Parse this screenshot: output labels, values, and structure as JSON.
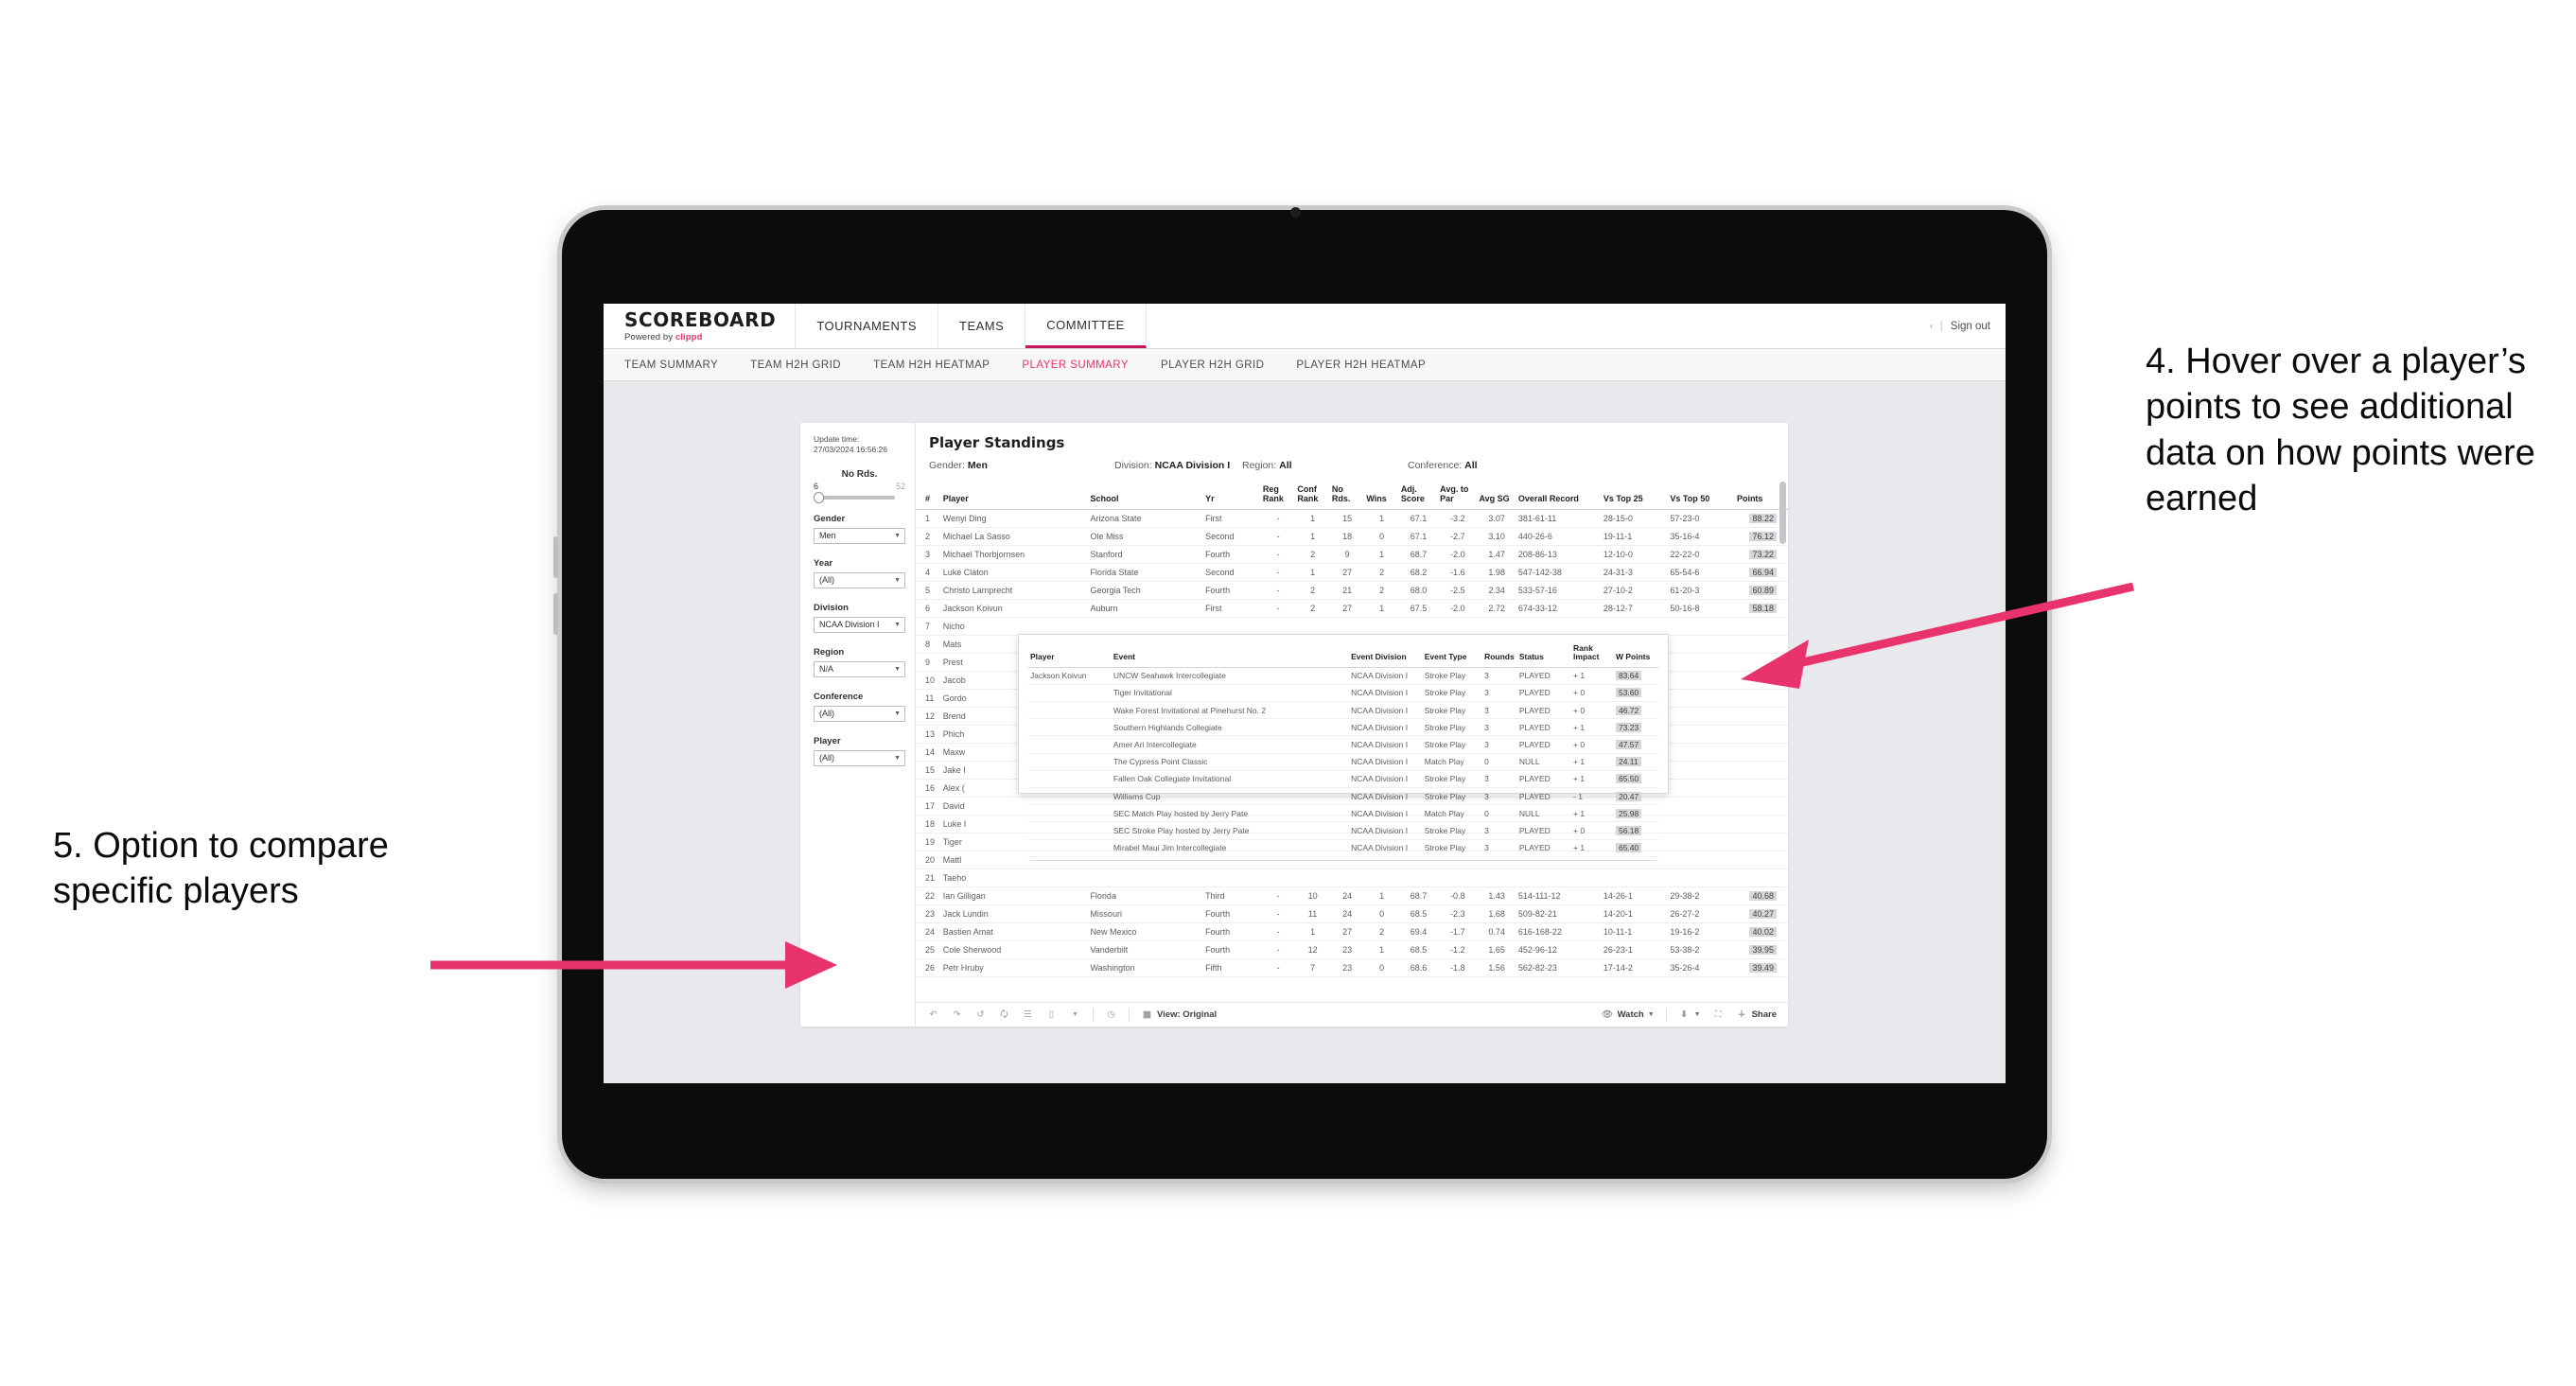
{
  "brand": {
    "title": "SCOREBOARD",
    "powered_prefix": "Powered by ",
    "powered_name": "clippd",
    "accent": "#e8336d"
  },
  "topnav": {
    "items": [
      "TOURNAMENTS",
      "TEAMS",
      "COMMITTEE"
    ],
    "active": "COMMITTEE",
    "sign_out": "Sign out",
    "divider": "|",
    "caret": "‹"
  },
  "subnav": {
    "items": [
      "TEAM SUMMARY",
      "TEAM H2H GRID",
      "TEAM H2H HEATMAP",
      "PLAYER SUMMARY",
      "PLAYER H2H GRID",
      "PLAYER H2H HEATMAP"
    ],
    "active": "PLAYER SUMMARY",
    "active_color": "#e8336d"
  },
  "update": {
    "label": "Update time:",
    "value": "27/03/2024 16:56:26"
  },
  "panel": {
    "title": "Player Standings",
    "meta": [
      {
        "label": "Gender: ",
        "value": "Men"
      },
      {
        "label": "Division: ",
        "value": "NCAA Division I"
      },
      {
        "label": "Region: ",
        "value": "All"
      },
      {
        "label": "Conference: ",
        "value": "All"
      }
    ]
  },
  "filters": {
    "slider": {
      "title": "No Rds.",
      "min": "6",
      "max": "52"
    },
    "groups": [
      {
        "label": "Gender",
        "value": "Men"
      },
      {
        "label": "Year",
        "value": "(All)"
      },
      {
        "label": "Division",
        "value": "NCAA Division I"
      },
      {
        "label": "Region",
        "value": "N/A"
      },
      {
        "label": "Conference",
        "value": "(All)"
      },
      {
        "label": "Player",
        "value": "(All)"
      }
    ]
  },
  "table": {
    "headers": [
      "#",
      "Player",
      "School",
      "Yr",
      "Reg Rank",
      "Conf Rank",
      "No Rds.",
      "Wins",
      "Adj. Score",
      "Avg. to Par",
      "Avg SG",
      "Overall Record",
      "Vs Top 25",
      "Vs Top 50",
      "Points"
    ],
    "rows": [
      {
        "rank": "1",
        "player": "Wenyi Ding",
        "school": "Arizona State",
        "yr": "First",
        "reg": "-",
        "conf": "1",
        "rds": "15",
        "wins": "1",
        "adj": "67.1",
        "par": "-3.2",
        "sg": "3.07",
        "record": "381-61-11",
        "t25": "28-15-0",
        "t50": "57-23-0",
        "points": "88.22"
      },
      {
        "rank": "2",
        "player": "Michael La Sasso",
        "school": "Ole Miss",
        "yr": "Second",
        "reg": "-",
        "conf": "1",
        "rds": "18",
        "wins": "0",
        "adj": "67.1",
        "par": "-2.7",
        "sg": "3.10",
        "record": "440-26-6",
        "t25": "19-11-1",
        "t50": "35-16-4",
        "points": "76.12"
      },
      {
        "rank": "3",
        "player": "Michael Thorbjornsen",
        "school": "Stanford",
        "yr": "Fourth",
        "reg": "-",
        "conf": "2",
        "rds": "9",
        "wins": "1",
        "adj": "68.7",
        "par": "-2.0",
        "sg": "1.47",
        "record": "208-86-13",
        "t25": "12-10-0",
        "t50": "22-22-0",
        "points": "73.22"
      },
      {
        "rank": "4",
        "player": "Luke Claton",
        "school": "Florida State",
        "yr": "Second",
        "reg": "-",
        "conf": "1",
        "rds": "27",
        "wins": "2",
        "adj": "68.2",
        "par": "-1.6",
        "sg": "1.98",
        "record": "547-142-38",
        "t25": "24-31-3",
        "t50": "65-54-6",
        "points": "66.94"
      },
      {
        "rank": "5",
        "player": "Christo Lamprecht",
        "school": "Georgia Tech",
        "yr": "Fourth",
        "reg": "-",
        "conf": "2",
        "rds": "21",
        "wins": "2",
        "adj": "68.0",
        "par": "-2.5",
        "sg": "2.34",
        "record": "533-57-16",
        "t25": "27-10-2",
        "t50": "61-20-3",
        "points": "60.89"
      },
      {
        "rank": "6",
        "player": "Jackson Koivun",
        "school": "Auburn",
        "yr": "First",
        "reg": "-",
        "conf": "2",
        "rds": "27",
        "wins": "1",
        "adj": "67.5",
        "par": "-2.0",
        "sg": "2.72",
        "record": "674-33-12",
        "t25": "28-12-7",
        "t50": "50-16-8",
        "points": "58.18"
      }
    ],
    "hidden_rows": [
      {
        "rank": "7",
        "player": "Nicho"
      },
      {
        "rank": "8",
        "player": "Mats"
      },
      {
        "rank": "9",
        "player": "Prest"
      },
      {
        "rank": "10",
        "player": "Jacob"
      },
      {
        "rank": "11",
        "player": "Gordo"
      },
      {
        "rank": "12",
        "player": "Brend"
      },
      {
        "rank": "13",
        "player": "Phich"
      },
      {
        "rank": "14",
        "player": "Maxw"
      },
      {
        "rank": "15",
        "player": "Jake I"
      },
      {
        "rank": "16",
        "player": "Alex ("
      },
      {
        "rank": "17",
        "player": "David"
      },
      {
        "rank": "18",
        "player": "Luke I"
      },
      {
        "rank": "19",
        "player": "Tiger"
      },
      {
        "rank": "20",
        "player": "Mattl"
      },
      {
        "rank": "21",
        "player": "Taeho"
      }
    ],
    "bottom_rows": [
      {
        "rank": "22",
        "player": "Ian Gilligan",
        "school": "Florida",
        "yr": "Third",
        "reg": "-",
        "conf": "10",
        "rds": "24",
        "wins": "1",
        "adj": "68.7",
        "par": "-0.8",
        "sg": "1.43",
        "record": "514-111-12",
        "t25": "14-26-1",
        "t50": "29-38-2",
        "points": "40.68"
      },
      {
        "rank": "23",
        "player": "Jack Lundin",
        "school": "Missouri",
        "yr": "Fourth",
        "reg": "-",
        "conf": "11",
        "rds": "24",
        "wins": "0",
        "adj": "68.5",
        "par": "-2.3",
        "sg": "1.68",
        "record": "509-82-21",
        "t25": "14-20-1",
        "t50": "26-27-2",
        "points": "40.27"
      },
      {
        "rank": "24",
        "player": "Bastien Amat",
        "school": "New Mexico",
        "yr": "Fourth",
        "reg": "-",
        "conf": "1",
        "rds": "27",
        "wins": "2",
        "adj": "69.4",
        "par": "-1.7",
        "sg": "0.74",
        "record": "616-168-22",
        "t25": "10-11-1",
        "t50": "19-16-2",
        "points": "40.02"
      },
      {
        "rank": "25",
        "player": "Cole Sherwood",
        "school": "Vanderbilt",
        "yr": "Fourth",
        "reg": "-",
        "conf": "12",
        "rds": "23",
        "wins": "1",
        "adj": "68.5",
        "par": "-1.2",
        "sg": "1.65",
        "record": "452-96-12",
        "t25": "26-23-1",
        "t50": "53-38-2",
        "points": "39.95"
      },
      {
        "rank": "26",
        "player": "Petr Hruby",
        "school": "Washington",
        "yr": "Fifth",
        "reg": "-",
        "conf": "7",
        "rds": "23",
        "wins": "0",
        "adj": "68.6",
        "par": "-1.8",
        "sg": "1.56",
        "record": "562-82-23",
        "t25": "17-14-2",
        "t50": "35-26-4",
        "points": "39.49"
      }
    ]
  },
  "tooltip": {
    "headers": [
      "Player",
      "Event",
      "Event Division",
      "Event Type",
      "Rounds",
      "Status",
      "Rank Impact",
      "W Points"
    ],
    "player": "Jackson Koivun",
    "rows": [
      {
        "event": "UNCW Seahawk Intercollegiate",
        "division": "NCAA Division I",
        "type": "Stroke Play",
        "rounds": "3",
        "status": "PLAYED",
        "impact": "+ 1",
        "wpoints": "83.64"
      },
      {
        "event": "Tiger Invitational",
        "division": "NCAA Division I",
        "type": "Stroke Play",
        "rounds": "3",
        "status": "PLAYED",
        "impact": "+ 0",
        "wpoints": "53.60"
      },
      {
        "event": "Wake Forest Invitational at Pinehurst No. 2",
        "division": "NCAA Division I",
        "type": "Stroke Play",
        "rounds": "3",
        "status": "PLAYED",
        "impact": "+ 0",
        "wpoints": "46.72"
      },
      {
        "event": "Southern Highlands Collegiate",
        "division": "NCAA Division I",
        "type": "Stroke Play",
        "rounds": "3",
        "status": "PLAYED",
        "impact": "+ 1",
        "wpoints": "73.23"
      },
      {
        "event": "Amer Ari Intercollegiate",
        "division": "NCAA Division I",
        "type": "Stroke Play",
        "rounds": "3",
        "status": "PLAYED",
        "impact": "+ 0",
        "wpoints": "47.57"
      },
      {
        "event": "The Cypress Point Classic",
        "division": "NCAA Division I",
        "type": "Match Play",
        "rounds": "0",
        "status": "NULL",
        "impact": "+ 1",
        "wpoints": "24.11"
      },
      {
        "event": "Fallen Oak Collegiate Invitational",
        "division": "NCAA Division I",
        "type": "Stroke Play",
        "rounds": "3",
        "status": "PLAYED",
        "impact": "+ 1",
        "wpoints": "65.50"
      },
      {
        "event": "Williams Cup",
        "division": "NCAA Division I",
        "type": "Stroke Play",
        "rounds": "3",
        "status": "PLAYED",
        "impact": "- 1",
        "wpoints": "20.47"
      },
      {
        "event": "SEC Match Play hosted by Jerry Pate",
        "division": "NCAA Division I",
        "type": "Match Play",
        "rounds": "0",
        "status": "NULL",
        "impact": "+ 1",
        "wpoints": "25.98"
      },
      {
        "event": "SEC Stroke Play hosted by Jerry Pate",
        "division": "NCAA Division I",
        "type": "Stroke Play",
        "rounds": "3",
        "status": "PLAYED",
        "impact": "+ 0",
        "wpoints": "56.18"
      },
      {
        "event": "Mirabel Maui Jim Intercollegiate",
        "division": "NCAA Division I",
        "type": "Stroke Play",
        "rounds": "3",
        "status": "PLAYED",
        "impact": "+ 1",
        "wpoints": "65.40"
      }
    ]
  },
  "toolbar": {
    "view_label": "View: Original",
    "watch_label": "Watch",
    "share_label": "Share",
    "icons": [
      "undo-icon",
      "redo-icon",
      "revert-icon",
      "refresh-icon",
      "pause-icon",
      "alerts-icon",
      "caret-down-icon",
      "clock-icon",
      "view-icon",
      "eye-icon",
      "download-icon",
      "fullscreen-icon",
      "share-icon"
    ]
  },
  "annotations": {
    "right": "4. Hover over a player’s points to see additional data on how points were earned",
    "left": "5. Option to compare specific players",
    "arrow_color": "#e8336d"
  }
}
